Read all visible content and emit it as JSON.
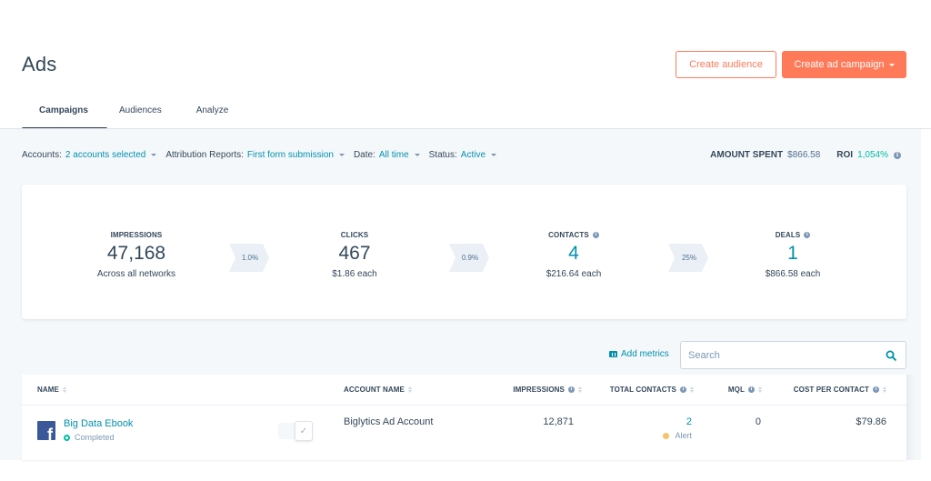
{
  "header": {
    "title": "Ads",
    "create_audience_label": "Create audience",
    "create_campaign_label": "Create ad campaign"
  },
  "tabs": [
    {
      "label": "Campaigns",
      "active": true
    },
    {
      "label": "Audiences",
      "active": false
    },
    {
      "label": "Analyze",
      "active": false
    }
  ],
  "filters": [
    {
      "label": "Accounts:",
      "value": "2 accounts selected"
    },
    {
      "label": "Attribution Reports:",
      "value": "First form submission"
    },
    {
      "label": "Date:",
      "value": "All time"
    },
    {
      "label": "Status:",
      "value": "Active"
    }
  ],
  "summary": {
    "amount_spent_label": "AMOUNT SPENT",
    "amount_spent_value": "$866.58",
    "roi_label": "ROI",
    "roi_value": "1,054%"
  },
  "funnel": {
    "stages": [
      {
        "label": "IMPRESSIONS",
        "value": "47,168",
        "sub": "Across all networks"
      },
      {
        "label": "CLICKS",
        "value": "467",
        "sub": "$1.86 each"
      },
      {
        "label": "CONTACTS",
        "value": "4",
        "sub": "$216.64 each"
      },
      {
        "label": "DEALS",
        "value": "1",
        "sub": "$866.58 each"
      }
    ],
    "rates": [
      "1.0%",
      "0.9%",
      "25%"
    ]
  },
  "toolbar": {
    "add_metrics_label": "Add metrics",
    "search_placeholder": "Search"
  },
  "table": {
    "columns": [
      "NAME",
      "ACCOUNT NAME",
      "IMPRESSIONS",
      "TOTAL CONTACTS",
      "MQL",
      "COST PER CONTACT"
    ],
    "rows": [
      {
        "network_icon": "facebook-icon",
        "name": "Big Data Ebook",
        "status": "Completed",
        "account_name": "Biglytics Ad Account",
        "impressions": "12,871",
        "total_contacts": "2",
        "contacts_alert": "Alert",
        "mql": "0",
        "cost_per_contact": "$79.86"
      }
    ]
  },
  "colors": {
    "accent": "#ff7a59",
    "link": "#0091ae",
    "text": "#33475b",
    "roi": "#00bda5",
    "alert": "#f5c26b",
    "facebook": "#3b5998"
  }
}
